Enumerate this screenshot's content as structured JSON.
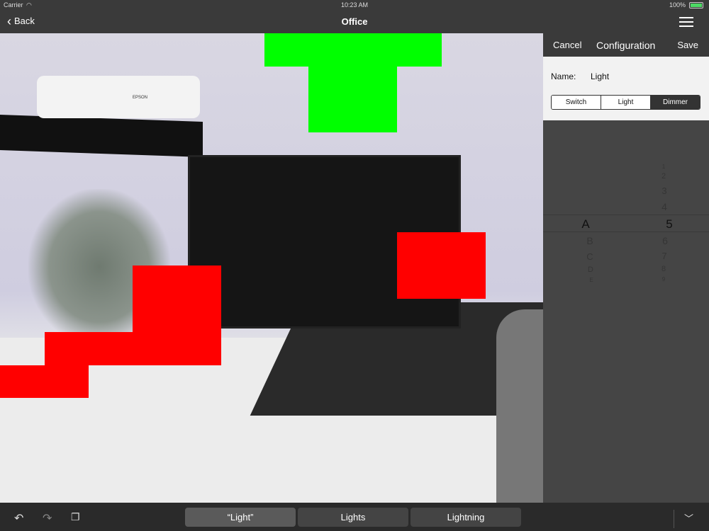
{
  "status": {
    "carrier": "Carrier",
    "time": "10:23 AM",
    "battery": "100%"
  },
  "nav": {
    "back_label": "Back",
    "title": "Office"
  },
  "config": {
    "cancel": "Cancel",
    "title": "Configuration",
    "save": "Save",
    "name_label": "Name:",
    "name_value": "Light",
    "segments": [
      "Switch",
      "Light",
      "Dimmer"
    ],
    "selected_segment": "Dimmer",
    "picker_letters": [
      "A",
      "B",
      "C",
      "D",
      "E"
    ],
    "picker_numbers": [
      "1",
      "2",
      "3",
      "4",
      "5",
      "6",
      "7",
      "8",
      "9"
    ],
    "selected_letter": "A",
    "selected_number": "5"
  },
  "photo": {
    "projector_brand": "EPSON"
  },
  "keyboard_bar": {
    "suggestions": [
      "“Light”",
      "Lights",
      "Lightning"
    ]
  },
  "colors": {
    "red_marker": "#ff0000",
    "green_marker": "#00ff00",
    "selected_segment": "#333333"
  }
}
